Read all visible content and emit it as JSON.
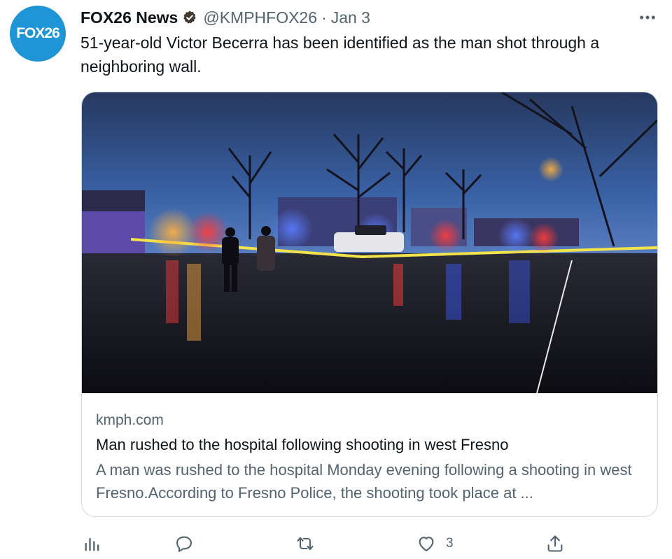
{
  "account": {
    "avatar_text": "FOX26",
    "display_name": "FOX26 News",
    "handle": "@KMPHFOX26",
    "separator": "·",
    "date": "Jan 3",
    "brand_color": "#1f95d6",
    "verified_icon": "verified-badge-icon"
  },
  "more_label": "•••",
  "tweet": {
    "text": "51-year-old Victor Becerra has been identified as the man shot through a neighboring wall."
  },
  "card": {
    "image_alt": "Police vehicles with flashing lights on a wet street at dusk",
    "domain": "kmph.com",
    "title": "Man rushed to the hospital following shooting in west Fresno",
    "description": "A man was rushed to the hospital Monday evening following a shooting in west Fresno.According to Fresno Police, the shooting took place at ..."
  },
  "actions": {
    "analytics_icon": "analytics-icon",
    "reply_icon": "reply-icon",
    "retweet_icon": "retweet-icon",
    "like_icon": "heart-icon",
    "like_count": "3",
    "share_icon": "share-icon"
  }
}
